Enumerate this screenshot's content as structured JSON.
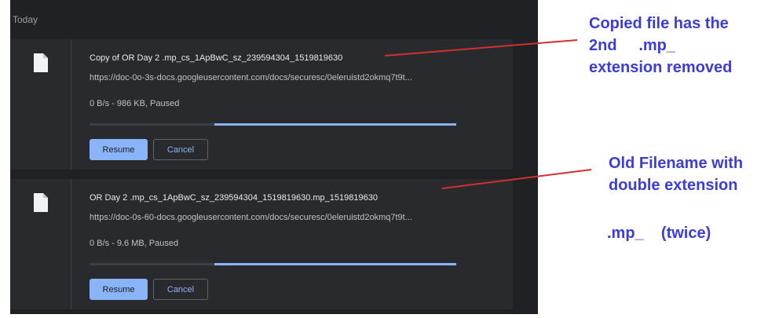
{
  "section_label": "Today",
  "downloads": [
    {
      "filename": "Copy of OR Day 2 .mp_cs_1ApBwC_sz_239594304_1519819630",
      "url": "https://doc-0o-3s-docs.googleusercontent.com/docs/securesc/0eleruistd2okmq7t9t...",
      "status": "0 B/s - 986 KB, Paused",
      "progress_fraction": 0.66,
      "resume_label": "Resume",
      "cancel_label": "Cancel",
      "icon": "file-icon"
    },
    {
      "filename": "OR Day 2 .mp_cs_1ApBwC_sz_239594304_1519819630.mp_1519819630",
      "url": "https://doc-0s-60-docs.googleusercontent.com/docs/securesc/0eleruistd2okmq7t9t...",
      "status": "0 B/s - 9.6 MB, Paused",
      "progress_fraction": 0.66,
      "resume_label": "Resume",
      "cancel_label": "Cancel",
      "icon": "file-icon"
    }
  ],
  "annotations": {
    "note1": "Copied file has the\n2nd     .mp_\nextension removed",
    "note2": "Old Filename with\ndouble extension",
    "note2b": ".mp_    (twice)",
    "text_color": "#3d3dd6",
    "line_color": "#d32f2f"
  },
  "colors": {
    "panel_bg": "#202124",
    "card_bg": "#292a2d",
    "accent": "#8ab4f8"
  }
}
